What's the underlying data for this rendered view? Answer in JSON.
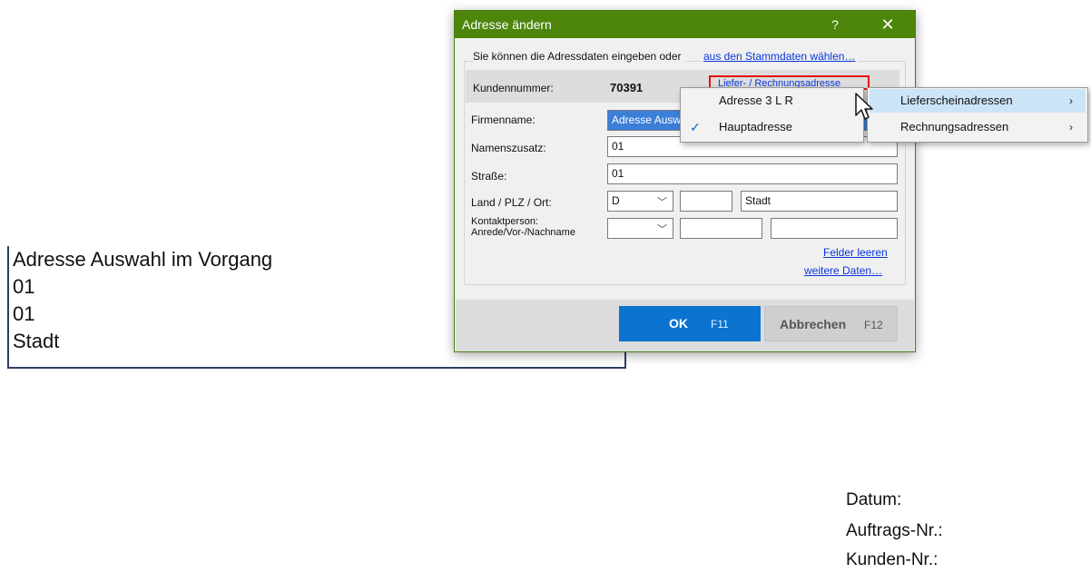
{
  "document": {
    "address_lines": [
      "Adresse Auswahl im Vorgang",
      "01",
      "01",
      "Stadt"
    ],
    "meta_labels": [
      "Datum:",
      "Auftrags-Nr.:",
      "Kunden-Nr.:"
    ]
  },
  "dialog": {
    "title": "Adresse ändern",
    "help_glyph": "?",
    "close_glyph": "✕",
    "intro_text": "Sie können die Adressdaten eingeben oder",
    "stamm_link": "aus den Stammdaten wählen…",
    "kunden_label": "Kundennummer:",
    "kunden_value": "70391",
    "liefer_link": "Liefer- / Rechnungsadresse",
    "fields": {
      "firma_label": "Firmenname:",
      "firma_value": "Adresse Ausw",
      "namenszusatz_label": "Namenszusatz:",
      "namenszusatz_value": "01",
      "strasse_label": "Straße:",
      "strasse_value": "01",
      "land_label": "Land / PLZ / Ort:",
      "land_value": "D",
      "plz_value": "",
      "ort_value": "Stadt",
      "kontakt_label_1": "Kontaktperson:",
      "kontakt_label_2": "Anrede/Vor-/Nachname",
      "anrede_value": "",
      "vorname_value": "",
      "nachname_value": ""
    },
    "felder_leeren": "Felder leeren",
    "weitere_daten": "weitere Daten…",
    "ok_label": "OK",
    "ok_key": "F11",
    "cancel_label": "Abbrechen",
    "cancel_key": "F12"
  },
  "menu_addresses": {
    "items": [
      {
        "label": "Adresse 3 L R",
        "checked": false
      },
      {
        "label": "Hauptadresse",
        "checked": true
      }
    ]
  },
  "menu_types": {
    "items": [
      {
        "label": "Lieferscheinadressen",
        "highlighted": true
      },
      {
        "label": "Rechnungsadressen",
        "highlighted": false
      }
    ]
  },
  "icons": {
    "combo_arrow": "chevron-down-icon",
    "submenu_arrow": "chevron-right-icon",
    "check": "checkmark-icon",
    "cursor": "mouse-pointer-icon"
  },
  "colors": {
    "titlebar": "#4e860c",
    "ok_button": "#0a74d0",
    "link": "#0a36d8",
    "highlight_box": "#e61010",
    "menu_highlight": "#cce4f7"
  }
}
